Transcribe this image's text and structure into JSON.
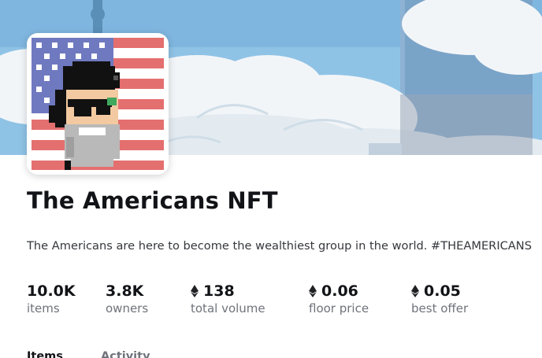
{
  "collection": {
    "title": "The Americans NFT",
    "description": "The Americans are here to become the wealthiest group in the world. #THEAMERICANS"
  },
  "banner": {
    "subject": "cloudy-sky-with-tower-and-skyscraper"
  },
  "avatar": {
    "subject": "pixel-art-bearded-man-with-eyepatch-on-us-flag"
  },
  "stats": [
    {
      "value": "10.0K",
      "label": "items",
      "eth": false
    },
    {
      "value": "3.8K",
      "label": "owners",
      "eth": false
    },
    {
      "value": "138",
      "label": "total volume",
      "eth": true
    },
    {
      "value": "0.06",
      "label": "floor price",
      "eth": true
    },
    {
      "value": "0.05",
      "label": "best offer",
      "eth": true
    }
  ],
  "tabs": [
    {
      "label": "Items",
      "active": true
    },
    {
      "label": "Activity",
      "active": false
    }
  ],
  "colors": {
    "sky": "#8fc3e6",
    "cloud": "#f4f6f8",
    "flag_red": "#e46f6f",
    "flag_blue": "#6f79c0",
    "text_primary": "#121317",
    "text_secondary": "#6f737b"
  }
}
